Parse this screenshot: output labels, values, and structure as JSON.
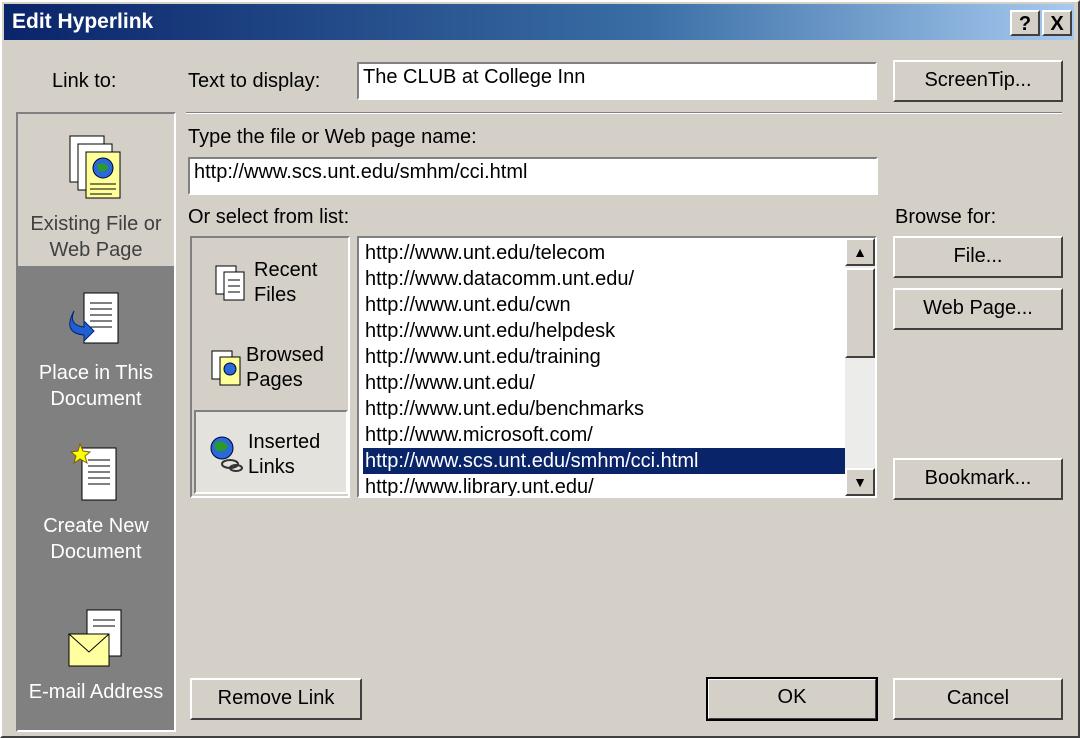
{
  "window": {
    "title": "Edit Hyperlink",
    "help_glyph": "?",
    "close_glyph": "X"
  },
  "sidebar": {
    "header": "Link to:",
    "items": [
      {
        "line1": "Existing File or",
        "line2": "Web Page",
        "icon": "existing-file-icon",
        "selected": true
      },
      {
        "line1": "Place in This",
        "line2": "Document",
        "icon": "place-in-document-icon"
      },
      {
        "line1": "Create New",
        "line2": "Document",
        "icon": "create-new-document-icon"
      },
      {
        "line1": "E-mail Address",
        "line2": "",
        "icon": "email-address-icon"
      }
    ]
  },
  "form": {
    "text_to_display_label": "Text to display:",
    "text_to_display_value": "The CLUB at College Inn",
    "screentip_label": "ScreenTip...",
    "file_label": "Type the file or Web page name:",
    "file_value": "http://www.scs.unt.edu/smhm/cci.html",
    "select_label": "Or select from list:",
    "browse_label": "Browse for:",
    "file_button": "File...",
    "webpage_button": "Web Page...",
    "bookmark_button": "Bookmark..."
  },
  "list_sources": [
    {
      "line1": "Recent",
      "line2": "Files",
      "icon": "recent-files-icon"
    },
    {
      "line1": "Browsed",
      "line2": "Pages",
      "icon": "browsed-pages-icon"
    },
    {
      "line1": "Inserted",
      "line2": "Links",
      "icon": "inserted-links-icon",
      "selected": true
    }
  ],
  "links": [
    "http://www.unt.edu/telecom",
    "http://www.datacomm.unt.edu/",
    "http://www.unt.edu/cwn",
    "http://www.unt.edu/helpdesk",
    "http://www.unt.edu/training",
    "http://www.unt.edu/",
    "http://www.unt.edu/benchmarks",
    "http://www.microsoft.com/",
    "http://www.scs.unt.edu/smhm/cci.html",
    "http://www.library.unt.edu/"
  ],
  "selected_link_index": 8,
  "footer": {
    "remove_link": "Remove Link",
    "ok": "OK",
    "cancel": "Cancel"
  },
  "colors": {
    "titlebar_start": "#0a246a",
    "selection": "#0a246a",
    "dialog_bg": "#d4d0c8",
    "sidebar_bg": "#808080"
  }
}
